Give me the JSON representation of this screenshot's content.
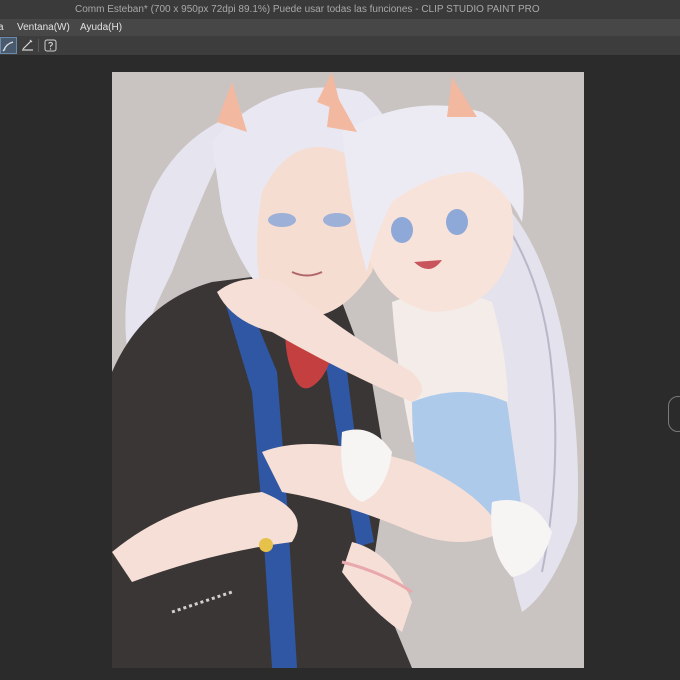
{
  "window": {
    "title": "Comm Esteban* (700 x 950px 72dpi 89.1%)  Puede usar todas las funciones - CLIP STUDIO PAINT PRO"
  },
  "menubar": {
    "items": [
      {
        "label": "a"
      },
      {
        "label": "Ventana(W)"
      },
      {
        "label": "Ayuda(H)"
      }
    ]
  },
  "toolbar": {
    "icons": [
      "brush-stroke-icon",
      "ruler-pen-icon",
      "help-icon"
    ]
  },
  "canvas": {
    "background_color": "#c9c3c1",
    "content": "anime-illustration"
  }
}
